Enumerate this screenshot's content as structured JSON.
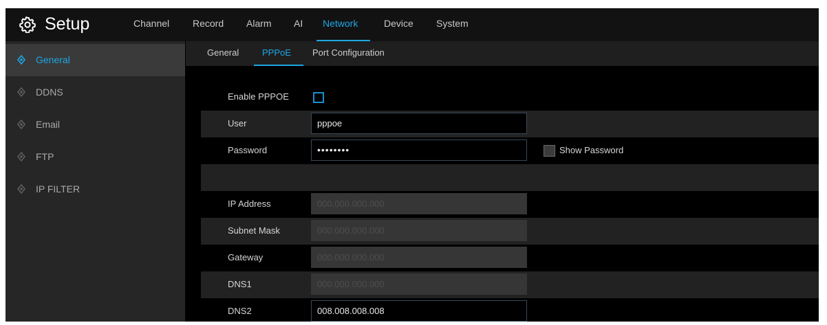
{
  "header": {
    "title": "Setup",
    "icon": "gear-icon",
    "nav": [
      "Channel",
      "Record",
      "Alarm",
      "AI",
      "Network",
      "Device",
      "System"
    ],
    "active_nav": "Network"
  },
  "sidebar": {
    "items": [
      {
        "label": "General",
        "active": true
      },
      {
        "label": "DDNS",
        "active": false
      },
      {
        "label": "Email",
        "active": false
      },
      {
        "label": "FTP",
        "active": false
      },
      {
        "label": "IP FILTER",
        "active": false
      }
    ]
  },
  "subtabs": {
    "items": [
      "General",
      "PPPoE",
      "Port Configuration"
    ],
    "active": "PPPoE"
  },
  "form": {
    "enable_pppoe": {
      "label": "Enable PPPOE",
      "checked": false
    },
    "user": {
      "label": "User",
      "value": "pppoe"
    },
    "password": {
      "label": "Password",
      "value": "••••••••",
      "show_password_label": "Show Password",
      "show_password_checked": false
    },
    "ip_address": {
      "label": "IP Address",
      "value": "000.000.000.000",
      "disabled": true
    },
    "subnet_mask": {
      "label": "Subnet Mask",
      "value": "000.000.000.000",
      "disabled": true
    },
    "gateway": {
      "label": "Gateway",
      "value": "000.000.000.000",
      "disabled": true
    },
    "dns1": {
      "label": "DNS1",
      "value": "000.000.000.000",
      "disabled": true
    },
    "dns2": {
      "label": "DNS2",
      "value": "008.008.008.008",
      "disabled": false
    }
  },
  "colors": {
    "accent": "#1ea7e4",
    "background": "#000000",
    "sidebar": "#262626"
  }
}
